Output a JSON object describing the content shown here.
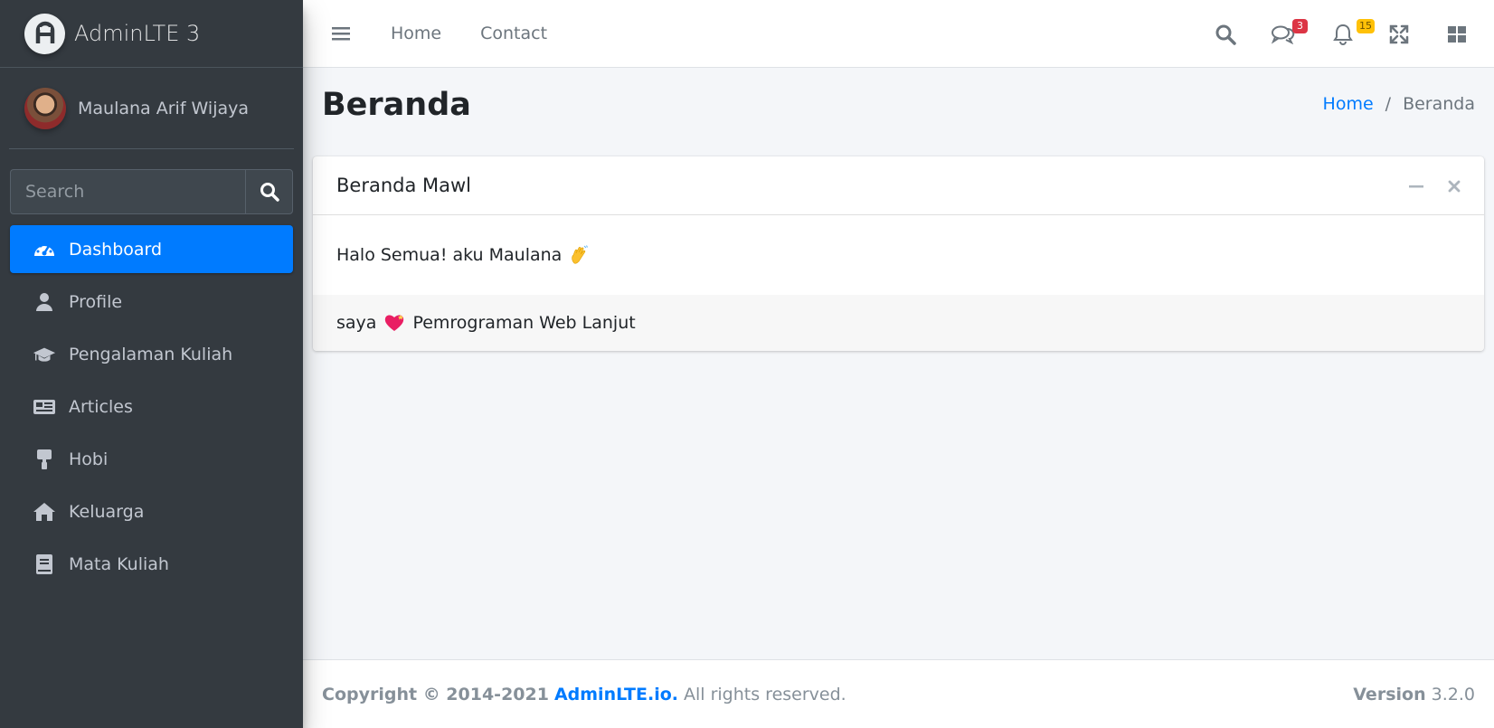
{
  "brand": {
    "name": "AdminLTE 3"
  },
  "user": {
    "name": "Maulana Arif Wijaya"
  },
  "search": {
    "placeholder": "Search"
  },
  "sidebar": {
    "items": [
      {
        "label": "Dashboard",
        "icon": "tachometer-icon",
        "active": true
      },
      {
        "label": "Profile",
        "icon": "user-icon"
      },
      {
        "label": "Pengalaman Kuliah",
        "icon": "graduation-cap-icon"
      },
      {
        "label": "Articles",
        "icon": "newspaper-icon"
      },
      {
        "label": "Hobi",
        "icon": "paint-roller-icon"
      },
      {
        "label": "Keluarga",
        "icon": "home-icon"
      },
      {
        "label": "Mata Kuliah",
        "icon": "book-icon"
      }
    ]
  },
  "navbar": {
    "links": [
      "Home",
      "Contact"
    ],
    "messages_count": "3",
    "notifications_count": "15"
  },
  "page": {
    "title": "Beranda"
  },
  "breadcrumb": {
    "home": "Home",
    "separator": "/",
    "current": "Beranda"
  },
  "card": {
    "title": "Beranda Mawl",
    "body": "Halo Semua! aku Maulana",
    "footer_before": "saya",
    "footer_after": "Pemrograman Web Lanjut"
  },
  "footer": {
    "copyright": "Copyright © 2014-2021",
    "link": "AdminLTE.io.",
    "rights": "All rights reserved.",
    "version_label": "Version",
    "version": "3.2.0"
  },
  "colors": {
    "sidebar_bg": "#343a40",
    "accent": "#007bff",
    "content_bg": "#f4f6f9",
    "badge_danger": "#dc3545",
    "badge_warning": "#ffc107"
  }
}
